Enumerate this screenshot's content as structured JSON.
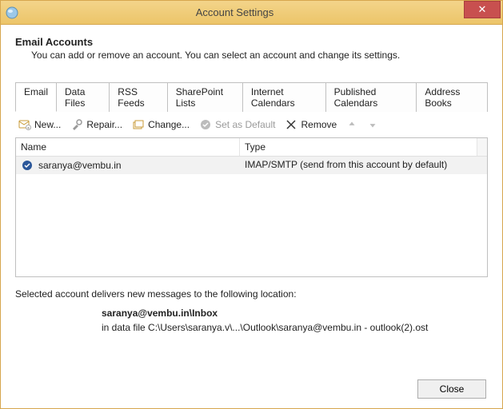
{
  "titlebar": {
    "title": "Account Settings",
    "close": "✕"
  },
  "header": {
    "title": "Email Accounts",
    "subtitle": "You can add or remove an account. You can select an account and change its settings."
  },
  "tabs": [
    {
      "label": "Email",
      "active": true
    },
    {
      "label": "Data Files"
    },
    {
      "label": "RSS Feeds"
    },
    {
      "label": "SharePoint Lists"
    },
    {
      "label": "Internet Calendars"
    },
    {
      "label": "Published Calendars"
    },
    {
      "label": "Address Books"
    }
  ],
  "toolbar": {
    "new": "New...",
    "repair": "Repair...",
    "change": "Change...",
    "default": "Set as Default",
    "remove": "Remove"
  },
  "list": {
    "col_name": "Name",
    "col_type": "Type",
    "rows": [
      {
        "name": "saranya@vembu.in",
        "type": "IMAP/SMTP (send from this account by default)"
      }
    ]
  },
  "delivery": {
    "intro": "Selected account delivers new messages to the following location:",
    "mailbox": "saranya@vembu.in\\Inbox",
    "path": "in data file C:\\Users\\saranya.v\\...\\Outlook\\saranya@vembu.in - outlook(2).ost"
  },
  "footer": {
    "close": "Close"
  }
}
